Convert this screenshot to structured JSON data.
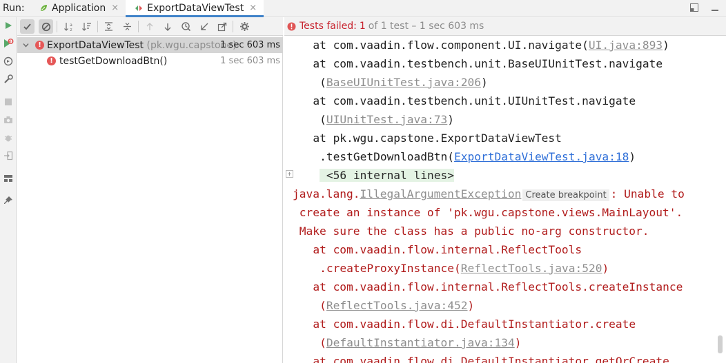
{
  "run_bar": {
    "label": "Run:",
    "tabs": [
      {
        "label": "Application",
        "icon": "spring-boot-icon",
        "close": "×"
      },
      {
        "label": "ExportDataViewTest",
        "icon": "test-config-icon",
        "close": "×"
      }
    ],
    "right_icons": [
      "restore-layout-icon",
      "minimize-icon"
    ]
  },
  "left_toolbar_icons": [
    "rerun-icon",
    "rerun-failed-icon",
    "toggle-auto-test-icon",
    "settings-wrench-icon",
    "stop-icon",
    "snapshot-camera-icon",
    "debug-bug-icon",
    "import-tests-icon",
    "layout-icon",
    "pin-icon"
  ],
  "test_toolbar_icons": [
    "show-passed-icon",
    "show-ignored-icon",
    "sort-alphabetically-icon",
    "sort-by-duration-icon",
    "expand-all-icon",
    "collapse-all-icon",
    "previous-failed-icon",
    "next-failed-icon",
    "test-history-icon",
    "import-results-icon",
    "export-results-icon",
    "settings-gear-icon"
  ],
  "status": {
    "failed_label": "Tests failed:",
    "failed_count": "1",
    "rest": "of 1 test – 1 sec 603 ms"
  },
  "tree": {
    "root": {
      "name": "ExportDataViewTest",
      "package": "(pk.wgu.capstone)",
      "duration": "1 sec 603 ms"
    },
    "children": [
      {
        "name": "testGetDownloadBtn()",
        "duration": "1 sec 603 ms"
      }
    ]
  },
  "console": {
    "lines": [
      {
        "type": "out",
        "indent": "   ",
        "text": "at com.vaadin.flow.component.UI.navigate(",
        "link": "UI.java:893",
        "link_style": "gray",
        "after": ")"
      },
      {
        "type": "out",
        "indent": "   ",
        "text": "at com.vaadin.testbench.unit.BaseUIUnitTest.navigate",
        "link": "",
        "link_style": "",
        "after": ""
      },
      {
        "type": "out",
        "indent": "    ",
        "text": "(",
        "link": "BaseUIUnitTest.java:206",
        "link_style": "gray",
        "after": ")"
      },
      {
        "type": "out",
        "indent": "   ",
        "text": "at com.vaadin.testbench.unit.UIUnitTest.navigate",
        "link": "",
        "link_style": "",
        "after": ""
      },
      {
        "type": "out",
        "indent": "    ",
        "text": "(",
        "link": "UIUnitTest.java:73",
        "link_style": "gray",
        "after": ")"
      },
      {
        "type": "out",
        "indent": "   ",
        "text": "at pk.wgu.capstone.ExportDataViewTest",
        "link": "",
        "link_style": "",
        "after": ""
      },
      {
        "type": "out",
        "indent": "    ",
        "text": ".testGetDownloadBtn(",
        "link": "ExportDataViewTest.java:18",
        "link_style": "blue",
        "after": ")"
      },
      {
        "type": "internal",
        "indent": "    ",
        "text": " <56 internal lines>",
        "link": "",
        "link_style": "",
        "after": ""
      },
      {
        "type": "exception",
        "indent": "",
        "text": "java.lang.",
        "link": "IllegalArgumentException",
        "link_style": "gray",
        "breakpoint": "Create breakpoint",
        "after": ": Unable to"
      },
      {
        "type": "err",
        "indent": " ",
        "text": "create an instance of 'pk.wgu.capstone.views.MainLayout'.",
        "link": "",
        "link_style": "",
        "after": ""
      },
      {
        "type": "err",
        "indent": " ",
        "text": "Make sure the class has a public no-arg constructor.",
        "link": "",
        "link_style": "",
        "after": ""
      },
      {
        "type": "err",
        "indent": "   ",
        "text": "at com.vaadin.flow.internal.ReflectTools",
        "link": "",
        "link_style": "",
        "after": ""
      },
      {
        "type": "err",
        "indent": "    ",
        "text": ".createProxyInstance(",
        "link": "ReflectTools.java:520",
        "link_style": "gray",
        "after": ")"
      },
      {
        "type": "err",
        "indent": "   ",
        "text": "at com.vaadin.flow.internal.ReflectTools.createInstance",
        "link": "",
        "link_style": "",
        "after": ""
      },
      {
        "type": "err",
        "indent": "    ",
        "text": "(",
        "link": "ReflectTools.java:452",
        "link_style": "gray",
        "after": ")"
      },
      {
        "type": "err",
        "indent": "   ",
        "text": "at com.vaadin.flow.di.DefaultInstantiator.create",
        "link": "",
        "link_style": "",
        "after": ""
      },
      {
        "type": "err",
        "indent": "    ",
        "text": "(",
        "link": "DefaultInstantiator.java:134",
        "link_style": "gray",
        "after": ")"
      },
      {
        "type": "err",
        "indent": "   ",
        "text": "at com.vaadin.flow.di.DefaultInstantiator.getOrCreate",
        "link": "",
        "link_style": "",
        "after": ""
      }
    ]
  },
  "colors": {
    "error": "#c7222d",
    "link_blue": "#2f6fd8",
    "selection": "#d5d5d5",
    "tab_accent": "#4083c9"
  }
}
